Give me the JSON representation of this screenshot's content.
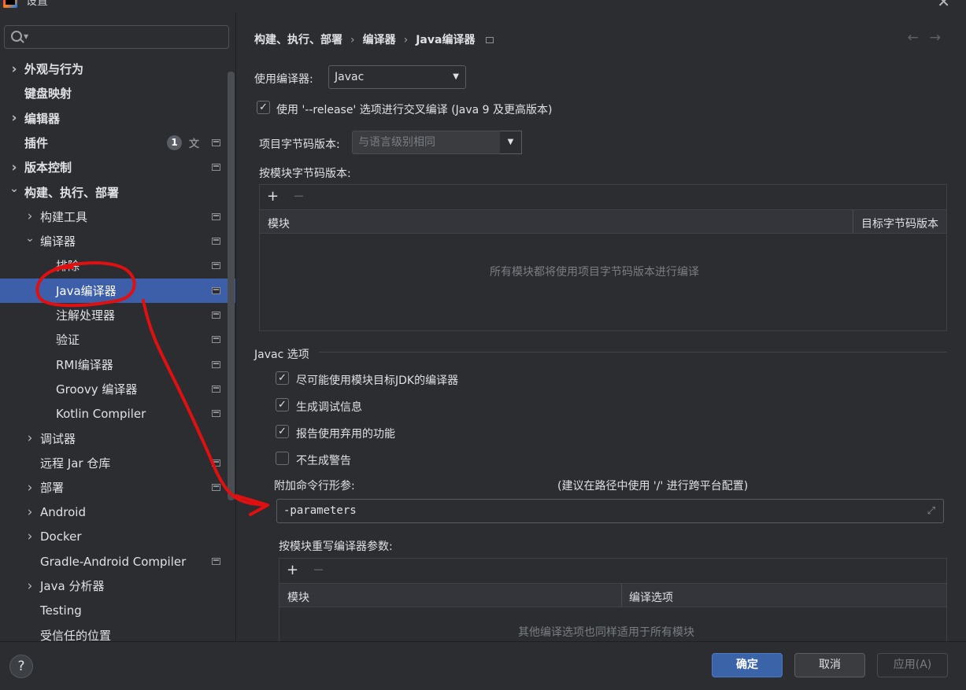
{
  "window": {
    "title": "设置"
  },
  "sidebar": {
    "items": [
      {
        "label": "外观与行为",
        "bold": true,
        "chevron": "›",
        "expanded": false
      },
      {
        "label": "键盘映射",
        "bold": true
      },
      {
        "label": "编辑器",
        "bold": true,
        "chevron": "›",
        "expanded": false
      },
      {
        "label": "插件",
        "bold": true,
        "badge": "1"
      },
      {
        "label": "版本控制",
        "bold": true,
        "chevron": "›",
        "expanded": false
      },
      {
        "label": "构建、执行、部署",
        "bold": true,
        "chevron": "⌄",
        "expanded": true
      },
      {
        "label": "构建工具",
        "chevron": "›",
        "expanded": false
      },
      {
        "label": "编译器",
        "chevron": "⌄",
        "expanded": true
      },
      {
        "label": "排除"
      },
      {
        "label": "Java编译器",
        "selected": true
      },
      {
        "label": "注解处理器"
      },
      {
        "label": "验证"
      },
      {
        "label": "RMI编译器"
      },
      {
        "label": "Groovy 编译器"
      },
      {
        "label": "Kotlin Compiler"
      },
      {
        "label": "调试器",
        "chevron": "›",
        "expanded": false
      },
      {
        "label": "远程 Jar 仓库"
      },
      {
        "label": "部署",
        "chevron": "›",
        "expanded": false
      },
      {
        "label": "Android",
        "chevron": "›",
        "expanded": false
      },
      {
        "label": "Docker",
        "chevron": "›",
        "expanded": false
      },
      {
        "label": "Gradle-Android Compiler"
      },
      {
        "label": "Java 分析器",
        "chevron": "›",
        "expanded": false
      },
      {
        "label": "Testing"
      },
      {
        "label": "受信任的位置"
      }
    ]
  },
  "breadcrumb": {
    "part1": "构建、执行、部署",
    "part2": "编译器",
    "part3": "Java编译器"
  },
  "main": {
    "compiler_label": "使用编译器:",
    "compiler_value": "Javac",
    "release_option": {
      "label": "使用 '--release' 选项进行交叉编译 (Java 9 及更高版本)",
      "checked": true
    },
    "bytecode_label": "项目字节码版本:",
    "bytecode_placeholder": "与语言级别相同",
    "per_module_label": "按模块字节码版本:",
    "per_module_table": {
      "col1": "模块",
      "col2": "目标字节码版本",
      "empty_text": "所有模块都将使用项目字节码版本进行编译"
    },
    "javac_section_title": "Javac 选项",
    "javac_options": [
      {
        "label": "尽可能使用模块目标JDK的编译器",
        "checked": true
      },
      {
        "label": "生成调试信息",
        "checked": true
      },
      {
        "label": "报告使用弃用的功能",
        "checked": true
      },
      {
        "label": "不生成警告",
        "checked": false
      }
    ],
    "cmd_params_label": "附加命令行形参:",
    "cmd_params_hint": "(建议在路径中使用 '/' 进行跨平台配置)",
    "cmd_params_value": "-parameters",
    "override_label": "按模块重写编译器参数:",
    "override_table": {
      "col1": "模块",
      "col2": "编译选项",
      "empty_text": "其他编译选项也同样适用于所有模块"
    }
  },
  "buttons": {
    "ok": "确定",
    "cancel": "取消",
    "apply": "应用(A)"
  },
  "help": "?",
  "colors": {
    "accent": "#3b64a8",
    "selection": "#3d5ea8",
    "annotation": "#e01010"
  }
}
